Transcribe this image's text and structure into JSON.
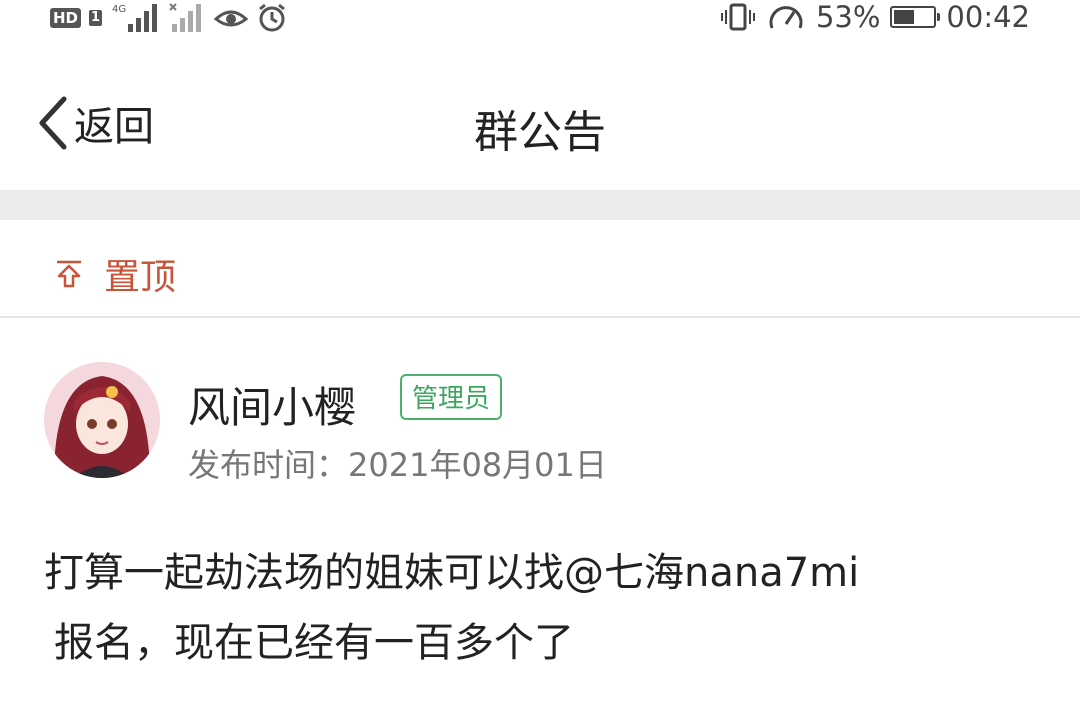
{
  "status_bar": {
    "hd_label": "HD",
    "sim_label": "1",
    "network_label": "4G",
    "battery_percent": "53%",
    "battery_level": 0.53,
    "time": "00:42",
    "icons": [
      "signal-icon",
      "no-signal-icon",
      "eye-icon",
      "alarm-icon",
      "vibrate-icon",
      "speed-icon",
      "battery-icon"
    ]
  },
  "header": {
    "back_label": "返回",
    "title": "群公告"
  },
  "pinned": {
    "label": "置顶",
    "icon": "pin-top-icon",
    "color": "#c8543a"
  },
  "post": {
    "author": "风间小樱",
    "role_badge": "管理员",
    "badge_color": "#3ea65f",
    "publish_time": "发布时间：2021年08月01日",
    "content_line1": "打算一起劫法场的姐妹可以找@七海nana7mi",
    "content_line2": "报名，现在已经有一百多个了"
  }
}
